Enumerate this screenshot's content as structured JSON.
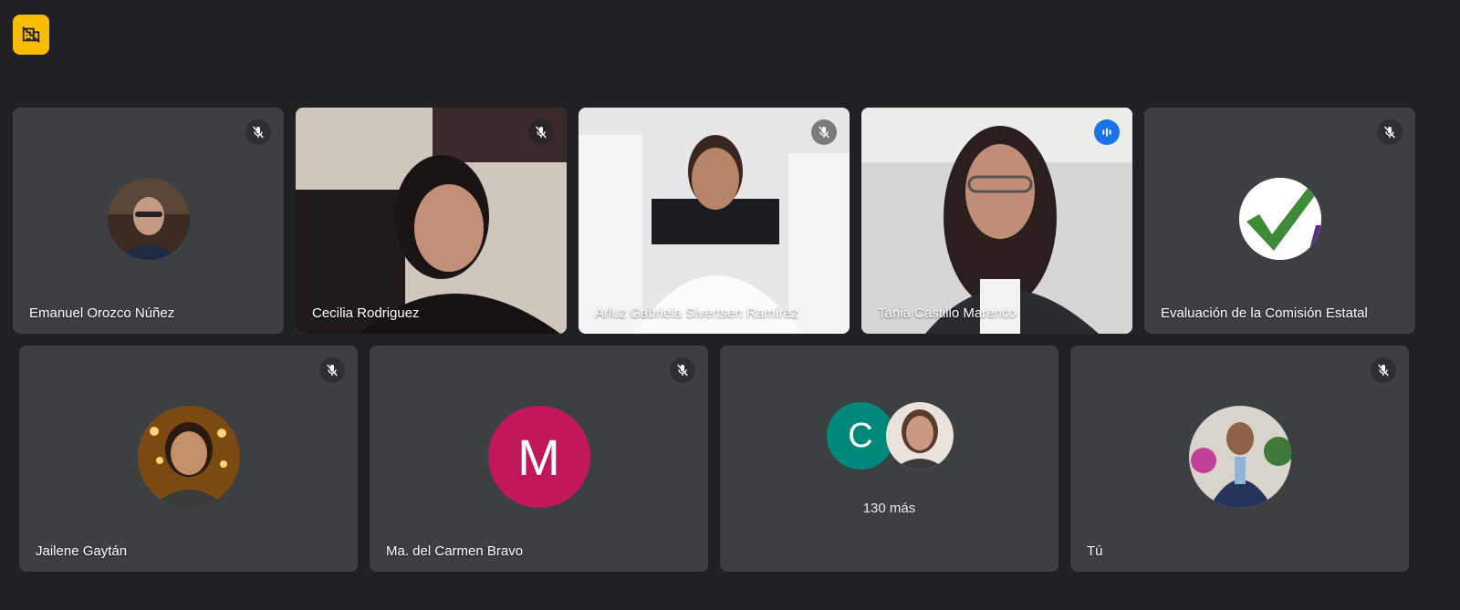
{
  "colors": {
    "background": "#202124",
    "tile": "#3c4043",
    "speaking_border": "#8ab4f8",
    "badge": "#fbbc04",
    "avatar_m": "#c2185b",
    "avatar_c": "#00897b"
  },
  "badge": {
    "icon": "no-camera-icon"
  },
  "participants": [
    {
      "name": "Emanuel Orozco Núñez",
      "mic": "muted"
    },
    {
      "name": "Cecilia Rodriguez",
      "mic": "muted"
    },
    {
      "name": "Arluz Gabriela Sivertsen Ramírez",
      "mic": "muted"
    },
    {
      "name": "Tania Castillo Marenco",
      "mic": "speaking"
    },
    {
      "name": "Evaluación de la Comisión Estatal",
      "mic": "muted"
    },
    {
      "name": "Jailene Gaytán",
      "mic": "muted"
    },
    {
      "name": "Ma. del Carmen Bravo",
      "mic": "muted",
      "avatar_letter": "M"
    },
    {
      "name": "Tú",
      "mic": "muted"
    }
  ],
  "others": {
    "avatar_letter": "C",
    "more_label": "130 más"
  }
}
